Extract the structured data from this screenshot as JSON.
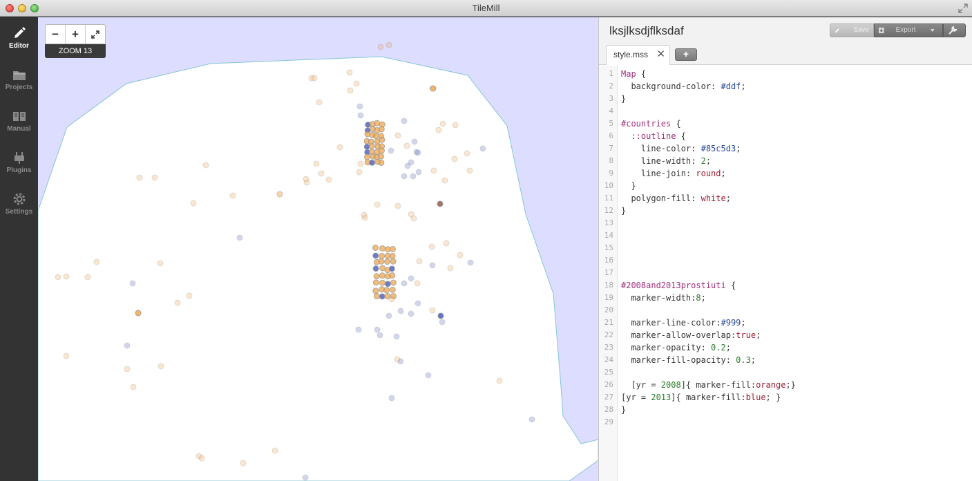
{
  "window": {
    "title": "TileMill"
  },
  "sidebar": {
    "items": [
      {
        "label": "Editor",
        "icon": "pencil-icon",
        "active": true
      },
      {
        "label": "Projects",
        "icon": "folder-icon",
        "active": false
      },
      {
        "label": "Manual",
        "icon": "book-icon",
        "active": false
      },
      {
        "label": "Plugins",
        "icon": "plug-icon",
        "active": false
      },
      {
        "label": "Settings",
        "icon": "gear-icon",
        "active": false
      }
    ]
  },
  "map": {
    "zoom_label": "ZOOM 13",
    "zoom_out_label": "−",
    "zoom_in_label": "+",
    "background_color": "#ddddff",
    "land_color": "#ffffff",
    "outline_color": "#85c5d3"
  },
  "editor": {
    "project_title": "lksjlksdjflksdaf",
    "toolbar": {
      "save_label": "Save",
      "export_label": "Export"
    },
    "tab_label": "style.mss",
    "tab_close": "✕",
    "add_tab": "+",
    "code_lines": [
      "Map {",
      "  background-color: #ddf;",
      "}",
      "",
      "#countries {",
      "  ::outline {",
      "    line-color: #85c5d3;",
      "    line-width: 2;",
      "    line-join: round;",
      "  }",
      "  polygon-fill: white;",
      "}",
      "",
      "",
      "",
      "",
      "",
      "#2008and2013prostiuti {",
      "  marker-width:8;",
      "",
      "  marker-line-color:#999;",
      "  marker-allow-overlap:true;",
      "  marker-opacity: 0.2;",
      "  marker-fill-opacity: 0.3;",
      "",
      "  [yr = 2008]{ marker-fill:orange;}",
      "[yr = 2013]{ marker-fill:blue; }",
      "}",
      ""
    ],
    "line_numbers": [
      "1",
      "2",
      "3",
      "4",
      "5",
      "6",
      "7",
      "8",
      "9",
      "10",
      "11",
      "12",
      "13",
      "14",
      "15",
      "16",
      "17",
      "18",
      "19",
      "20",
      "21",
      "22",
      "23",
      "24",
      "25",
      "26",
      "27",
      "28",
      "29"
    ]
  }
}
